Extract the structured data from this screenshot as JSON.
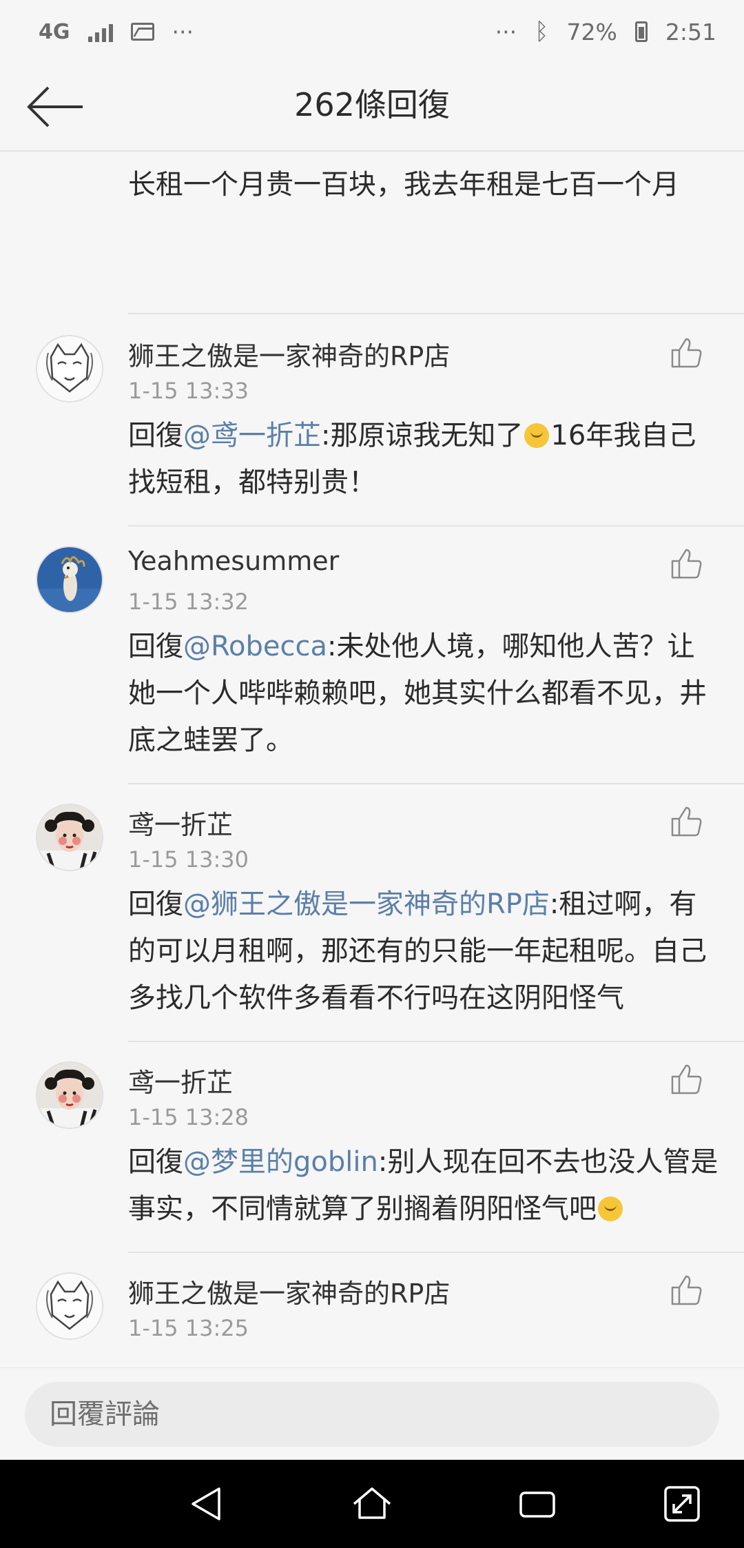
{
  "status_bar": {
    "network": "4G",
    "more_left": "···",
    "more_right": "···",
    "battery": "72%",
    "time": "2:51"
  },
  "header": {
    "title": "262條回復"
  },
  "partial_comment": {
    "text": "改成几个单间出租的这种一般可以短租，不过比长租一个月贵一百块，我去年租是七百一个月"
  },
  "comments": [
    {
      "username": "狮王之傲是一家神奇的RP店",
      "time": "1-15 13:33",
      "reply_prefix": "回復",
      "mention": "@鸢一折芷",
      "text_a": ":那原谅我无知了",
      "emoji": "face-with-hand-over-mouth",
      "text_b": "16年我自己找短租，都特别贵！"
    },
    {
      "username": "Yeahmesummer",
      "time": "1-15 13:32",
      "reply_prefix": "回復",
      "mention": "@Robecca",
      "text_a": ":未处他人境，哪知他人苦？让她一个人哔哔赖赖吧，她其实什么都看不见，井底之蛙罢了。"
    },
    {
      "username": "鸢一折芷",
      "time": "1-15 13:30",
      "reply_prefix": "回復",
      "mention": "@狮王之傲是一家神奇的RP店",
      "text_a": ":租过啊，有的可以月租啊，那还有的只能一年起租呢。自己多找几个软件多看看不行吗在这阴阳怪气"
    },
    {
      "username": "鸢一折芷",
      "time": "1-15 13:28",
      "reply_prefix": "回復",
      "mention": "@梦里的goblin",
      "text_a": ":别人现在回不去也没人管是事实，不同情就算了别搁着阴阳怪气吧",
      "emoji": "smirking-face"
    },
    {
      "username": "狮王之傲是一家神奇的RP店",
      "time": "1-15 13:25"
    }
  ],
  "reply_bar": {
    "placeholder": "回覆評論"
  },
  "colors": {
    "mention": "#5b7fa8",
    "background": "#f6f6f6",
    "nav_background": "#000000"
  }
}
